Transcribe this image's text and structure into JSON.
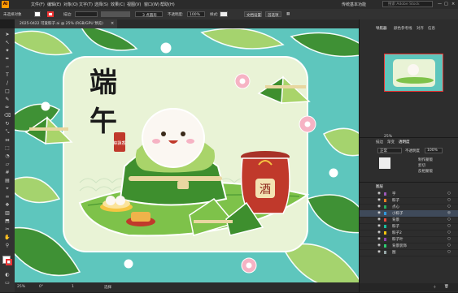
{
  "app": {
    "logo": "Ai"
  },
  "menu": [
    "文件(F)",
    "编辑(E)",
    "对象(O)",
    "文字(T)",
    "选择(S)",
    "效果(C)",
    "视图(V)",
    "窗口(W)",
    "帮助(H)"
  ],
  "workspace": {
    "label": "传统基本功能",
    "search_placeholder": "搜索 Adobe Stock"
  },
  "control_bar": {
    "selection_label": "未选择对象",
    "stroke_label": "描边:",
    "stroke_weight": "3 点圆形",
    "opacity_label": "不透明度:",
    "opacity_value": "100%",
    "style_label": "样式:",
    "doc_setup": "文档设置",
    "prefs": "首选项"
  },
  "document_tab": {
    "title": "2025-0422 可爱粽子.ai @ 25% (RGB/GPU 预览)",
    "close": "×"
  },
  "status": {
    "zoom": "25%",
    "angle": "0°",
    "artboard": "1",
    "tool": "选择"
  },
  "navigator": {
    "tabs": [
      "导航器",
      "颜色参考线",
      "对齐",
      "信息"
    ],
    "zoom": "25%"
  },
  "transparency": {
    "tabs": [
      "描边",
      "渐变",
      "透明度"
    ],
    "mode": "正常",
    "opacity_label": "不透明度",
    "opacity": "100%",
    "make_mask": "制作蒙版",
    "clip": "剪切",
    "invert": "反相蒙版"
  },
  "layers_panel": {
    "title": "图层",
    "layers": [
      "字",
      "粽子",
      "点心",
      "小粽子",
      "背景",
      "粽子",
      "粽子2",
      "粽子叶",
      "背景装饰",
      "图"
    ]
  },
  "artwork": {
    "title_line1": "端",
    "title_line2": "午",
    "seal_text": "粽飘香",
    "jar_text": "酒",
    "colors": {
      "bg": "#5ec6bd",
      "panel": "#e9f3d6",
      "leaf_dark": "#3e8f2e",
      "leaf_light": "#a9d46a",
      "jar": "#c0392b",
      "flower": "#f6b3c4"
    }
  }
}
